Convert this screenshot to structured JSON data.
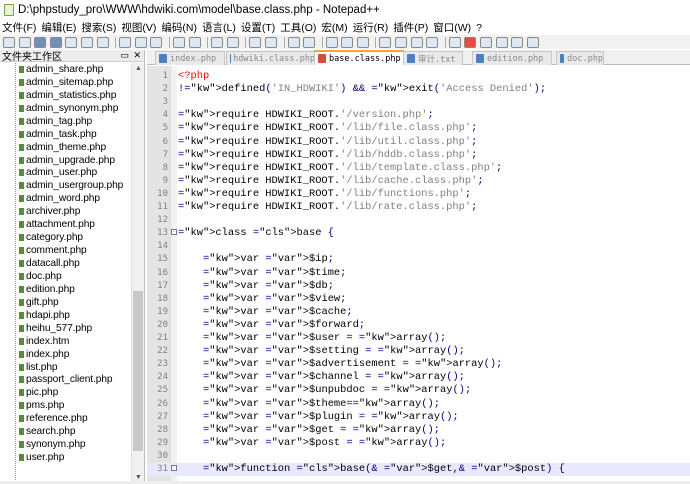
{
  "window": {
    "title": "D:\\phpstudy_pro\\WWW\\hdwiki.com\\model\\base.class.php - Notepad++"
  },
  "menu": [
    "文件(F)",
    "编辑(E)",
    "搜索(S)",
    "视图(V)",
    "编码(N)",
    "语言(L)",
    "设置(T)",
    "工具(O)",
    "宏(M)",
    "运行(R)",
    "插件(P)",
    "窗口(W)",
    "?"
  ],
  "toolbar": {
    "icons": [
      "new-file-icon",
      "open-file-icon",
      "save-icon",
      "save-all-icon",
      "close-icon",
      "close-all-icon",
      "print-icon",
      "cut-icon",
      "copy-icon",
      "paste-icon",
      "undo-icon",
      "redo-icon",
      "find-icon",
      "replace-icon",
      "zoom-in-icon",
      "zoom-out-icon",
      "sync-v-icon",
      "sync-h-icon",
      "word-wrap-icon",
      "all-chars-icon",
      "indent-guide-icon",
      "udl-icon",
      "doc-map-icon",
      "function-list-icon",
      "folder-workspace-icon",
      "monitor-icon",
      "record-macro-icon",
      "stop-record-icon",
      "play-macro-icon",
      "play-multi-icon",
      "save-macro-icon"
    ]
  },
  "side_panel": {
    "title": "文件夹工作区",
    "controls": "▭ ✕",
    "files": [
      "admin_share.php",
      "admin_sitemap.php",
      "admin_statistics.php",
      "admin_synonym.php",
      "admin_tag.php",
      "admin_task.php",
      "admin_theme.php",
      "admin_upgrade.php",
      "admin_user.php",
      "admin_usergroup.php",
      "admin_word.php",
      "archiver.php",
      "attachment.php",
      "category.php",
      "comment.php",
      "datacall.php",
      "doc.php",
      "edition.php",
      "gift.php",
      "hdapi.php",
      "heihu_577.php",
      "index.htm",
      "index.php",
      "list.php",
      "passport_client.php",
      "pic.php",
      "pms.php",
      "reference.php",
      "search.php",
      "synonym.php",
      "user.php"
    ]
  },
  "tabs": [
    {
      "label": "index.php",
      "active": false
    },
    {
      "label": "hdwiki.class.php",
      "active": false
    },
    {
      "label": "base.class.php",
      "active": true
    },
    {
      "label": "审计.txt",
      "active": false
    },
    {
      "label": "edition.php",
      "active": false
    },
    {
      "label": "doc.php",
      "active": false
    }
  ],
  "editor": {
    "current_line": 31,
    "lines": [
      {
        "n": "1",
        "t": "<?php"
      },
      {
        "n": "2",
        "t": "!defined('IN_HDWIKI') && exit('Access Denied');"
      },
      {
        "n": "3",
        "t": ""
      },
      {
        "n": "4",
        "t": "require HDWIKI_ROOT.'/version.php';"
      },
      {
        "n": "5",
        "t": "require HDWIKI_ROOT.'/lib/file.class.php';"
      },
      {
        "n": "6",
        "t": "require HDWIKI_ROOT.'/lib/util.class.php';"
      },
      {
        "n": "7",
        "t": "require HDWIKI_ROOT.'/lib/hddb.class.php';"
      },
      {
        "n": "8",
        "t": "require HDWIKI_ROOT.'/lib/template.class.php';"
      },
      {
        "n": "9",
        "t": "require HDWIKI_ROOT.'/lib/cache.class.php';"
      },
      {
        "n": "10",
        "t": "require HDWIKI_ROOT.'/lib/functions.php';"
      },
      {
        "n": "11",
        "t": "require HDWIKI_ROOT.'/lib/rate.class.php';"
      },
      {
        "n": "12",
        "t": ""
      },
      {
        "n": "13",
        "t": "class base {"
      },
      {
        "n": "14",
        "t": ""
      },
      {
        "n": "15",
        "t": "    var $ip;"
      },
      {
        "n": "16",
        "t": "    var $time;"
      },
      {
        "n": "17",
        "t": "    var $db;"
      },
      {
        "n": "18",
        "t": "    var $view;"
      },
      {
        "n": "19",
        "t": "    var $cache;"
      },
      {
        "n": "20",
        "t": "    var $forward;"
      },
      {
        "n": "21",
        "t": "    var $user = array();"
      },
      {
        "n": "22",
        "t": "    var $setting = array();"
      },
      {
        "n": "23",
        "t": "    var $advertisement = array();"
      },
      {
        "n": "24",
        "t": "    var $channel = array();"
      },
      {
        "n": "25",
        "t": "    var $unpubdoc = array();"
      },
      {
        "n": "26",
        "t": "    var $theme=array();"
      },
      {
        "n": "27",
        "t": "    var $plugin = array();"
      },
      {
        "n": "28",
        "t": "    var $get = array();"
      },
      {
        "n": "29",
        "t": "    var $post = array();"
      },
      {
        "n": "30",
        "t": ""
      },
      {
        "n": "31",
        "t": "    function base(& $get,& $post) {"
      }
    ]
  }
}
